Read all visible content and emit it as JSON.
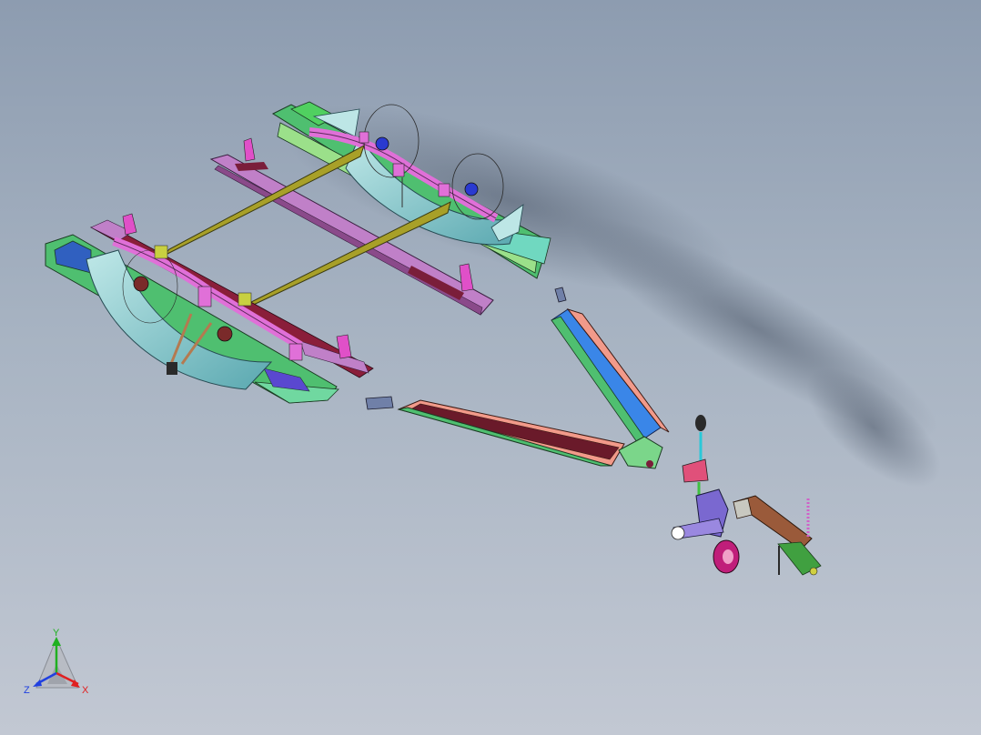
{
  "triad": {
    "x_label": "X",
    "y_label": "Y",
    "z_label": "Z",
    "x_color": "#e02020",
    "y_color": "#20b020",
    "z_color": "#2040e0"
  },
  "colors": {
    "background_top": "#8d9cb0",
    "background_bottom": "#c2c8d3",
    "frame_rail_green": "#58c46a",
    "drawbar_salmon": "#f29a8a",
    "drawbar_blue": "#3a86e8",
    "crossbar_olive": "#a8a028",
    "spring_magenta": "#e070d8",
    "fender_cyan": "#7fc8c8",
    "bed_purple": "#c080c8",
    "coupler_brown": "#9a5a3a",
    "jack_violet": "#7a68d0"
  }
}
